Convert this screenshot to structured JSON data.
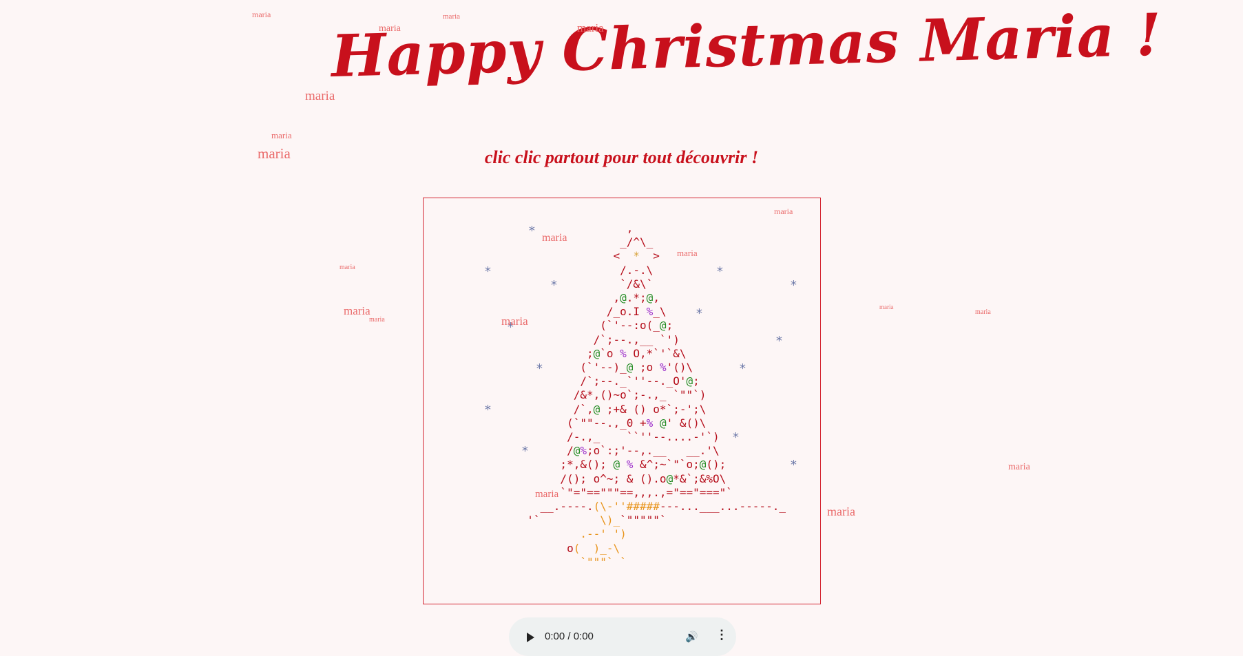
{
  "page": {
    "title": "Happy Christmas Maria !",
    "subtitle": "clic clic partout pour tout découvrir !"
  },
  "floating_word": "maria",
  "audio": {
    "time": "0:00 / 0:00"
  },
  "colors": {
    "accent_red": "#c8101c",
    "tree_red": "#b50d1a",
    "green": "#228b22",
    "purple": "#9a2bc9",
    "gold": "#d7a23a",
    "orange": "#e8941c",
    "floating_text": "#ea6a6a",
    "snow": "#6c78a8"
  },
  "icons": [
    "play-icon",
    "volume-icon",
    "more-options-icon",
    "snowflake-star-icon"
  ]
}
